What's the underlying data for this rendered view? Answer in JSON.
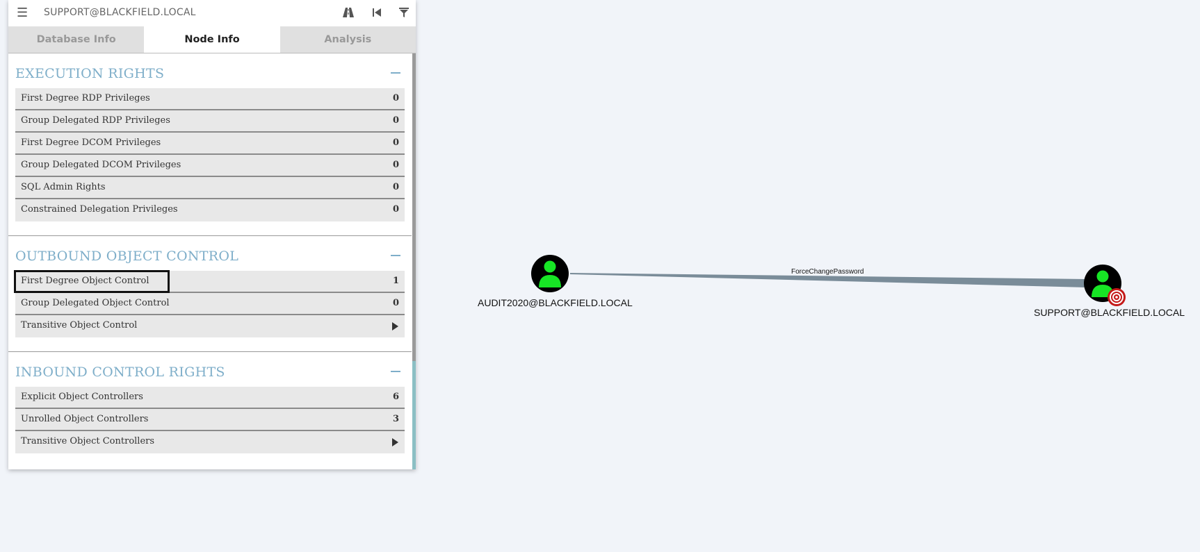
{
  "search": {
    "value": "SUPPORT@BLACKFIELD.LOCAL"
  },
  "toolbar": {
    "menu_icon": "hamburger-menu-icon",
    "pathfinding_icon": "pathfinding-road-icon",
    "back_icon": "back-icon",
    "filter_icon": "filter-icon"
  },
  "tabs": [
    {
      "label": "Database Info",
      "active": false
    },
    {
      "label": "Node Info",
      "active": true
    },
    {
      "label": "Analysis",
      "active": false
    }
  ],
  "sections": {
    "execution": {
      "title": "EXECUTION RIGHTS",
      "rows": [
        {
          "label": "First Degree RDP Privileges",
          "value": "0"
        },
        {
          "label": "Group Delegated RDP Privileges",
          "value": "0"
        },
        {
          "label": "First Degree DCOM Privileges",
          "value": "0"
        },
        {
          "label": "Group Delegated DCOM Privileges",
          "value": "0"
        },
        {
          "label": "SQL Admin Rights",
          "value": "0"
        },
        {
          "label": "Constrained Delegation Privileges",
          "value": "0"
        }
      ]
    },
    "outbound": {
      "title": "OUTBOUND OBJECT CONTROL",
      "rows": [
        {
          "label": "First Degree Object Control",
          "value": "1"
        },
        {
          "label": "Group Delegated Object Control",
          "value": "0"
        },
        {
          "label": "Transitive Object Control",
          "value": ""
        }
      ]
    },
    "inbound": {
      "title": "INBOUND CONTROL RIGHTS",
      "rows": [
        {
          "label": "Explicit Object Controllers",
          "value": "6"
        },
        {
          "label": "Unrolled Object Controllers",
          "value": "3"
        },
        {
          "label": "Transitive Object Controllers",
          "value": ""
        }
      ]
    }
  },
  "graph": {
    "nodes": [
      {
        "label": "AUDIT2020@BLACKFIELD.LOCAL",
        "icon": "user-icon"
      },
      {
        "label": "SUPPORT@BLACKFIELD.LOCAL",
        "icon": "user-icon",
        "badge": "target-icon"
      }
    ],
    "edge": {
      "label": "ForceChangePassword"
    },
    "colors": {
      "node_fill": "#000000",
      "user_green": "#17e625",
      "edge": "#7a8c99",
      "target_red": "#c41818"
    }
  }
}
